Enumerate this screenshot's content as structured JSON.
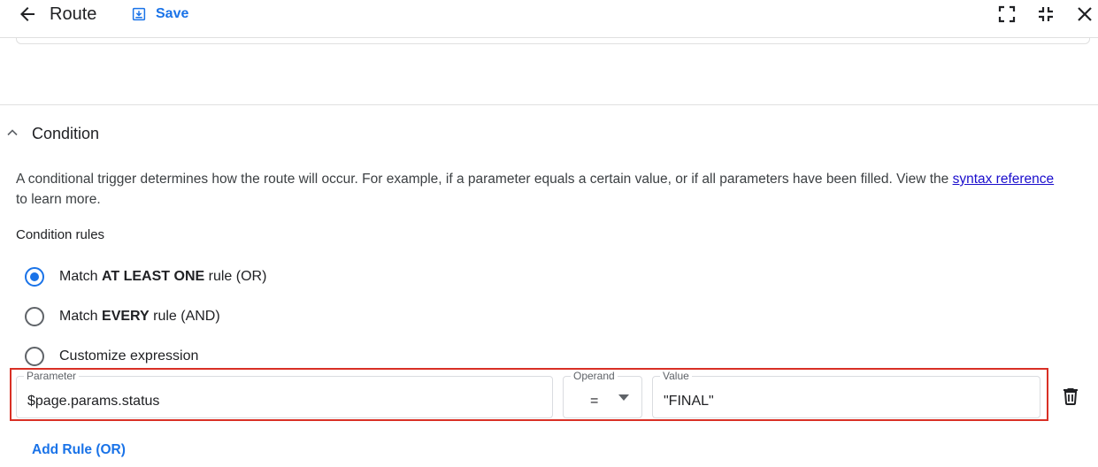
{
  "header": {
    "title": "Route",
    "save_label": "Save"
  },
  "condition": {
    "section_title": "Condition",
    "description_before": "A conditional trigger determines how the route will occur. For example, if a parameter equals a certain value, or if all parameters have been filled. View the ",
    "description_link": "syntax reference",
    "description_after": " to learn more.",
    "rules_label": "Condition rules",
    "options": [
      {
        "prefix": "Match ",
        "bold": "AT LEAST ONE",
        "suffix": " rule (OR)",
        "checked": true
      },
      {
        "prefix": "Match ",
        "bold": "EVERY",
        "suffix": " rule (AND)",
        "checked": false
      },
      {
        "prefix": "Customize expression",
        "bold": "",
        "suffix": "",
        "checked": false
      }
    ],
    "rule": {
      "parameter_label": "Parameter",
      "parameter_value": "$page.params.status",
      "operand_label": "Operand",
      "operand_value": "=",
      "value_label": "Value",
      "value_value": "\"FINAL\""
    },
    "add_rule_label": "Add Rule (OR)"
  },
  "colors": {
    "accent": "#1a73e8",
    "highlight": "#d93025"
  }
}
